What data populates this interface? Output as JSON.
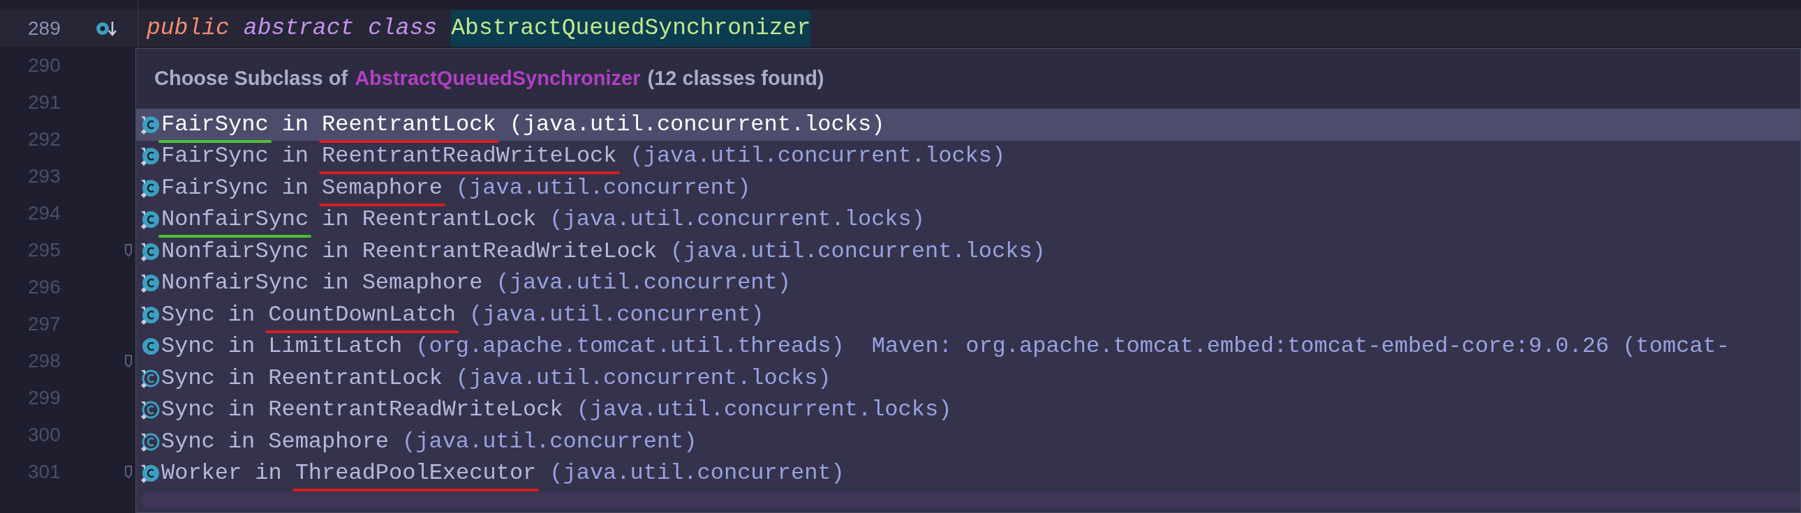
{
  "editor": {
    "lines": [
      {
        "number": "289",
        "current": true,
        "gutter_icon": true,
        "fold": false
      },
      {
        "number": "290",
        "current": false,
        "gutter_icon": false,
        "fold": false
      },
      {
        "number": "291",
        "current": false,
        "gutter_icon": false,
        "fold": false
      },
      {
        "number": "292",
        "current": false,
        "gutter_icon": false,
        "fold": false
      },
      {
        "number": "293",
        "current": false,
        "gutter_icon": false,
        "fold": false
      },
      {
        "number": "294",
        "current": false,
        "gutter_icon": false,
        "fold": false
      },
      {
        "number": "295",
        "current": false,
        "gutter_icon": false,
        "fold": true
      },
      {
        "number": "296",
        "current": false,
        "gutter_icon": false,
        "fold": false
      },
      {
        "number": "297",
        "current": false,
        "gutter_icon": false,
        "fold": false
      },
      {
        "number": "298",
        "current": false,
        "gutter_icon": false,
        "fold": true
      },
      {
        "number": "299",
        "current": false,
        "gutter_icon": false,
        "fold": false
      },
      {
        "number": "300",
        "current": false,
        "gutter_icon": false,
        "fold": false
      },
      {
        "number": "301",
        "current": false,
        "gutter_icon": false,
        "fold": true
      }
    ],
    "code": [
      {
        "kind": "modifier",
        "text": "public"
      },
      {
        "kind": "keyword",
        "text": "abstract"
      },
      {
        "kind": "keyword",
        "text": "class"
      },
      {
        "kind": "highlighted",
        "text": "AbstractQueuedSynchronizer"
      }
    ]
  },
  "popup": {
    "title_prefix": "Choose Subclass of",
    "title_class": "AbstractQueuedSynchronizer",
    "title_count": "(12 classes found)",
    "items": [
      {
        "kind": "nested",
        "name": "FairSync",
        "in": "in",
        "owner": "ReentrantLock",
        "package": "(java.util.concurrent.locks)",
        "selected": true,
        "name_underline": {
          "color": "#4cc23a"
        },
        "owner_underline": {
          "color": "#d42020"
        }
      },
      {
        "kind": "nested",
        "name": "FairSync",
        "in": "in",
        "owner": "ReentrantReadWriteLock",
        "package": "(java.util.concurrent.locks)",
        "selected": false,
        "owner_underline": {
          "color": "#d42020"
        }
      },
      {
        "kind": "nested",
        "name": "FairSync",
        "in": "in",
        "owner": "Semaphore",
        "package": "(java.util.concurrent)",
        "selected": false,
        "owner_underline": {
          "color": "#d42020"
        }
      },
      {
        "kind": "nested",
        "name": "NonfairSync",
        "in": "in",
        "owner": "ReentrantLock",
        "package": "(java.util.concurrent.locks)",
        "selected": false,
        "name_underline": {
          "color": "#4cc23a"
        }
      },
      {
        "kind": "nested",
        "name": "NonfairSync",
        "in": "in",
        "owner": "ReentrantReadWriteLock",
        "package": "(java.util.concurrent.locks)",
        "selected": false
      },
      {
        "kind": "nested",
        "name": "NonfairSync",
        "in": "in",
        "owner": "Semaphore",
        "package": "(java.util.concurrent)",
        "selected": false
      },
      {
        "kind": "nested",
        "name": "Sync",
        "in": "in",
        "owner": "CountDownLatch",
        "package": "(java.util.concurrent)",
        "selected": false,
        "owner_underline": {
          "color": "#d42020"
        }
      },
      {
        "kind": "plain",
        "name": "Sync",
        "in": "in",
        "owner": "LimitLatch",
        "package": "(org.apache.tomcat.util.threads)",
        "selected": false,
        "library": "Maven: org.apache.tomcat.embed:tomcat-embed-core:9.0.26 (tomcat-"
      },
      {
        "kind": "abstract",
        "name": "Sync",
        "in": "in",
        "owner": "ReentrantLock",
        "package": "(java.util.concurrent.locks)",
        "selected": false
      },
      {
        "kind": "abstract",
        "name": "Sync",
        "in": "in",
        "owner": "ReentrantReadWriteLock",
        "package": "(java.util.concurrent.locks)",
        "selected": false
      },
      {
        "kind": "abstract",
        "name": "Sync",
        "in": "in",
        "owner": "Semaphore",
        "package": "(java.util.concurrent)",
        "selected": false
      },
      {
        "kind": "nested",
        "name": "Worker",
        "in": "in",
        "owner": "ThreadPoolExecutor",
        "package": "(java.util.concurrent)",
        "selected": false,
        "owner_underline": {
          "color": "#d42020"
        }
      }
    ]
  }
}
